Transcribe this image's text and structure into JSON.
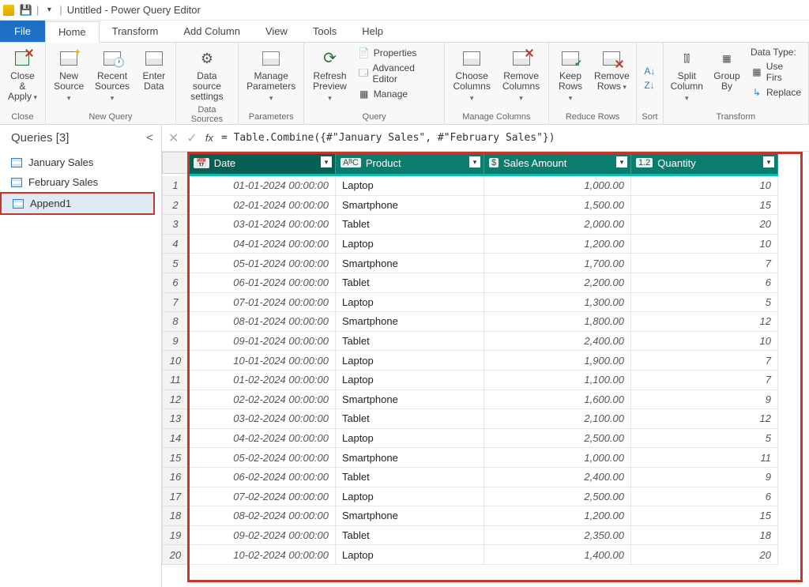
{
  "titlebar": {
    "title": "Untitled - Power Query Editor"
  },
  "tabs": {
    "file": "File",
    "home": "Home",
    "transform": "Transform",
    "addcolumn": "Add Column",
    "view": "View",
    "tools": "Tools",
    "help": "Help"
  },
  "ribbon": {
    "close": {
      "closeapply": "Close &\nApply",
      "group": "Close"
    },
    "newquery": {
      "newsource": "New\nSource",
      "recent": "Recent\nSources",
      "enter": "Enter\nData",
      "group": "New Query"
    },
    "datasources": {
      "settings": "Data source\nsettings",
      "group": "Data Sources"
    },
    "parameters": {
      "manage": "Manage\nParameters",
      "group": "Parameters"
    },
    "query": {
      "refresh": "Refresh\nPreview",
      "properties": "Properties",
      "advanced": "Advanced Editor",
      "manage": "Manage",
      "group": "Query"
    },
    "cols": {
      "choose": "Choose\nColumns",
      "remove": "Remove\nColumns",
      "group": "Manage Columns"
    },
    "rows": {
      "keep": "Keep\nRows",
      "remove": "Remove\nRows",
      "group": "Reduce Rows"
    },
    "sort": {
      "group": "Sort"
    },
    "transform": {
      "split": "Split\nColumn",
      "group": "Group\nBy",
      "datatype": "Data Type:",
      "usefirst": "Use Firs",
      "replace": "Replace",
      "tgroup": "Transform"
    }
  },
  "queries": {
    "title": "Queries [3]",
    "items": [
      {
        "label": "January Sales"
      },
      {
        "label": "February Sales"
      },
      {
        "label": "Append1"
      }
    ]
  },
  "formula": "= Table.Combine({#\"January Sales\", #\"February Sales\"})",
  "columns": [
    {
      "name": "Date",
      "type": "📅"
    },
    {
      "name": "Product",
      "type": "AᴮC"
    },
    {
      "name": "Sales Amount",
      "type": "$"
    },
    {
      "name": "Quantity",
      "type": "1.2"
    }
  ],
  "chart_data": {
    "type": "table",
    "columns": [
      "Date",
      "Product",
      "Sales Amount",
      "Quantity"
    ],
    "rows": [
      [
        "01-01-2024 00:00:00",
        "Laptop",
        "1,000.00",
        "10"
      ],
      [
        "02-01-2024 00:00:00",
        "Smartphone",
        "1,500.00",
        "15"
      ],
      [
        "03-01-2024 00:00:00",
        "Tablet",
        "2,000.00",
        "20"
      ],
      [
        "04-01-2024 00:00:00",
        "Laptop",
        "1,200.00",
        "10"
      ],
      [
        "05-01-2024 00:00:00",
        "Smartphone",
        "1,700.00",
        "7"
      ],
      [
        "06-01-2024 00:00:00",
        "Tablet",
        "2,200.00",
        "6"
      ],
      [
        "07-01-2024 00:00:00",
        "Laptop",
        "1,300.00",
        "5"
      ],
      [
        "08-01-2024 00:00:00",
        "Smartphone",
        "1,800.00",
        "12"
      ],
      [
        "09-01-2024 00:00:00",
        "Tablet",
        "2,400.00",
        "10"
      ],
      [
        "10-01-2024 00:00:00",
        "Laptop",
        "1,900.00",
        "7"
      ],
      [
        "01-02-2024 00:00:00",
        "Laptop",
        "1,100.00",
        "7"
      ],
      [
        "02-02-2024 00:00:00",
        "Smartphone",
        "1,600.00",
        "9"
      ],
      [
        "03-02-2024 00:00:00",
        "Tablet",
        "2,100.00",
        "12"
      ],
      [
        "04-02-2024 00:00:00",
        "Laptop",
        "2,500.00",
        "5"
      ],
      [
        "05-02-2024 00:00:00",
        "Smartphone",
        "1,000.00",
        "11"
      ],
      [
        "06-02-2024 00:00:00",
        "Tablet",
        "2,400.00",
        "9"
      ],
      [
        "07-02-2024 00:00:00",
        "Laptop",
        "2,500.00",
        "6"
      ],
      [
        "08-02-2024 00:00:00",
        "Smartphone",
        "1,200.00",
        "15"
      ],
      [
        "09-02-2024 00:00:00",
        "Tablet",
        "2,350.00",
        "18"
      ],
      [
        "10-02-2024 00:00:00",
        "Laptop",
        "1,400.00",
        "20"
      ]
    ]
  }
}
